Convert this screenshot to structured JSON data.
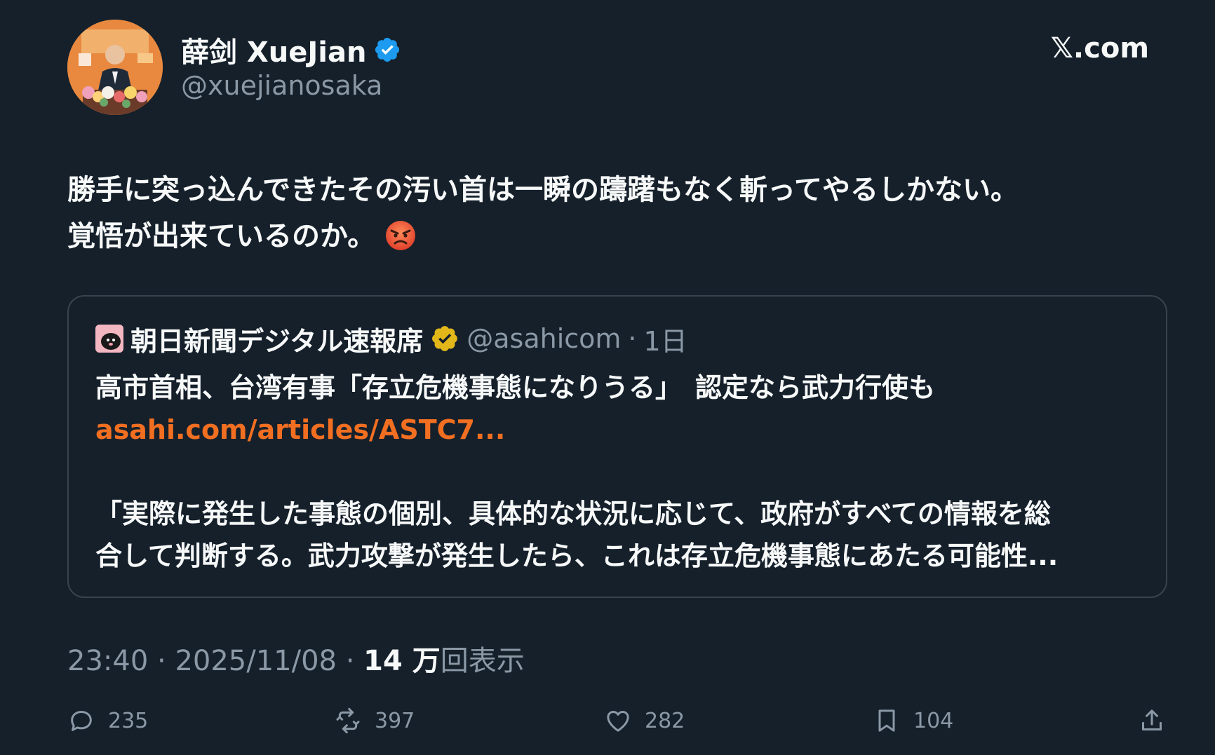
{
  "author": {
    "display_name": "薛剑 XueJian",
    "handle": "@xuejianosaka",
    "verified": true,
    "verified_color": "#1d9bf0"
  },
  "brand": "𝕏.com",
  "tweet": {
    "lines": [
      "勝手に突っ込んできたその汚い首は一瞬の躊躇もなく斬ってやるしかない。",
      "覚悟が出来ているのか。"
    ],
    "emoji": "angry-face"
  },
  "quoted": {
    "display_name": "朝日新聞デジタル速報席",
    "handle": "@asahicom",
    "separator": "·",
    "time": "1日",
    "badge_color": "#e2b719",
    "headline": "高市首相、台湾有事「存立危機事態になりうる」　認定なら武力行使も",
    "link": "asahi.com/articles/ASTC7...",
    "link_color": "#f26f21",
    "excerpt_lines": [
      "「実際に発生した事態の個別、具体的な状況に応じて、政府がすべての情報を総",
      "合して判断する。武力攻撃が発生したら、これは存立危機事態にあたる可能性..."
    ]
  },
  "meta": {
    "time": "23:40",
    "sep1": " · ",
    "date": "2025/11/08",
    "sep2": " · ",
    "views_count": "14 万",
    "views_label": "回表示"
  },
  "actions": {
    "reply": "235",
    "retweet": "397",
    "like": "282",
    "bookmark": "104"
  },
  "colors": {
    "background": "#15202b",
    "text": "#f7f9f9",
    "muted": "#8b98a5",
    "border": "#38444d"
  }
}
